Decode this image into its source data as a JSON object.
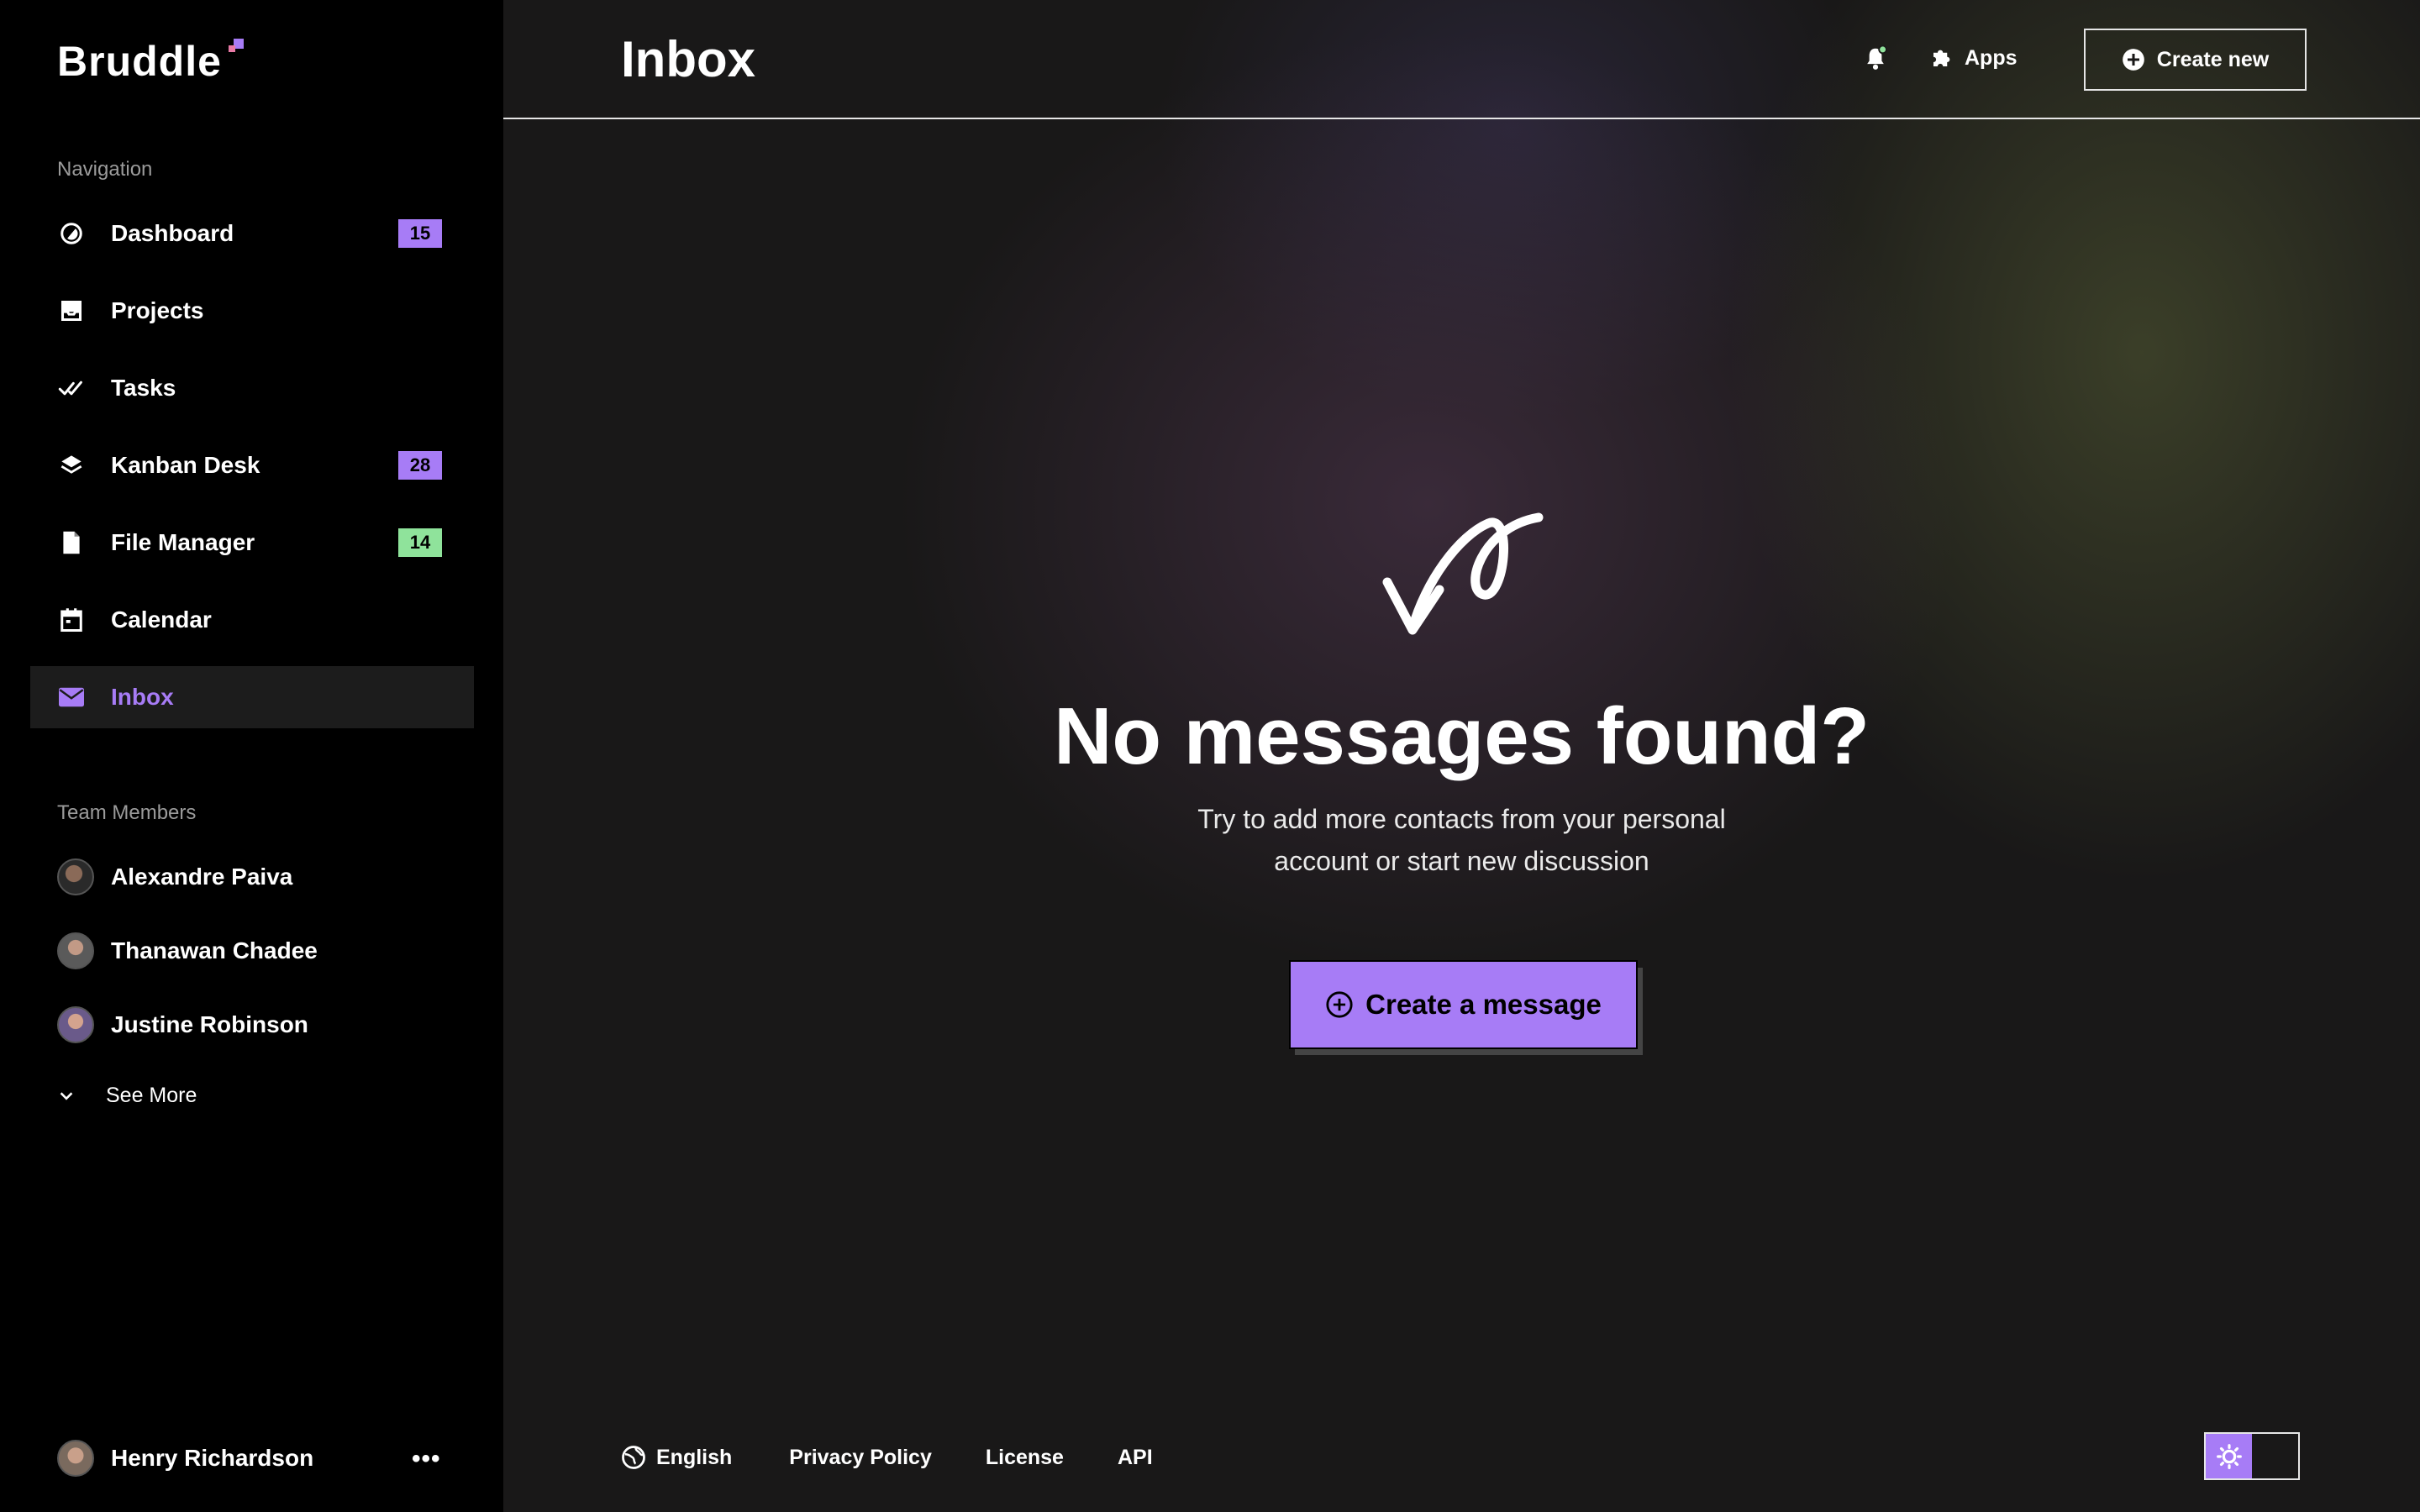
{
  "app": {
    "name": "Bruddle"
  },
  "colors": {
    "accent": "#a77cf6",
    "badge_green": "#8fe39b",
    "sidebar_bg": "#000000",
    "main_bg": "#191818"
  },
  "sidebar": {
    "nav_label": "Navigation",
    "items": [
      {
        "label": "Dashboard",
        "icon": "dashboard-icon",
        "badge": "15",
        "badge_color": "#a77cf6"
      },
      {
        "label": "Projects",
        "icon": "projects-icon"
      },
      {
        "label": "Tasks",
        "icon": "check-double-icon"
      },
      {
        "label": "Kanban Desk",
        "icon": "layers-icon",
        "badge": "28",
        "badge_color": "#a77cf6"
      },
      {
        "label": "File Manager",
        "icon": "file-icon",
        "badge": "14",
        "badge_color": "#8fe39b"
      },
      {
        "label": "Calendar",
        "icon": "calendar-icon"
      },
      {
        "label": "Inbox",
        "icon": "mail-icon",
        "active": true
      }
    ],
    "team_label": "Team Members",
    "members": [
      {
        "name": "Alexandre Paiva"
      },
      {
        "name": "Thanawan Chadee"
      },
      {
        "name": "Justine Robinson"
      }
    ],
    "see_more": "See More",
    "current_user": {
      "name": "Henry Richardson"
    }
  },
  "header": {
    "title": "Inbox",
    "apps_label": "Apps",
    "create_new_label": "Create new"
  },
  "empty_state": {
    "title": "No messages found?",
    "subtitle_line1": "Try to add more contacts from your personal",
    "subtitle_line2": "account or start new discussion",
    "button_label": "Create a message"
  },
  "footer": {
    "language": "English",
    "privacy": "Privacy Policy",
    "license": "License",
    "api": "API"
  },
  "theme": {
    "selected": "light"
  }
}
